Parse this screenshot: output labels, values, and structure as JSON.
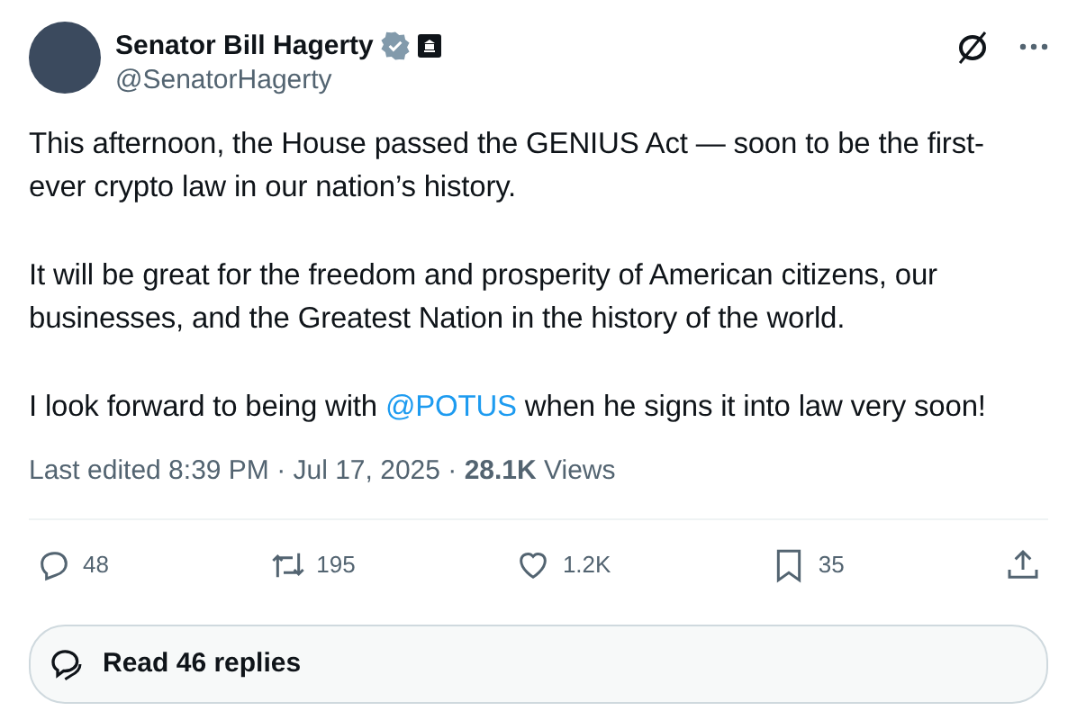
{
  "author": {
    "name": "Senator Bill Hagerty",
    "handle": "@SenatorHagerty",
    "verified": true
  },
  "body": [
    [
      {
        "kind": "text",
        "text": "This afternoon, the House passed the GENIUS Act — soon to be the first-ever crypto law in our nation’s history."
      }
    ],
    [
      {
        "kind": "text",
        "text": "It will be great for the freedom and prosperity of American citizens, our businesses, and the Greatest Nation in the history of the world."
      }
    ],
    [
      {
        "kind": "text",
        "text": "I look forward to being with "
      },
      {
        "kind": "mention",
        "text": "@POTUS"
      },
      {
        "kind": "text",
        "text": " when he signs it into law very soon!"
      }
    ]
  ],
  "meta": "Last edited 8:39 PM · Jul 17, 2025 · **28.1K** Views",
  "actions": [
    {
      "kind": "reply",
      "count": "48"
    },
    {
      "kind": "repost",
      "count": "195"
    },
    {
      "kind": "like",
      "count": "1.2K"
    },
    {
      "kind": "bookmark",
      "count": "35"
    },
    {
      "kind": "share"
    }
  ],
  "read_replies": "Read 46 replies"
}
